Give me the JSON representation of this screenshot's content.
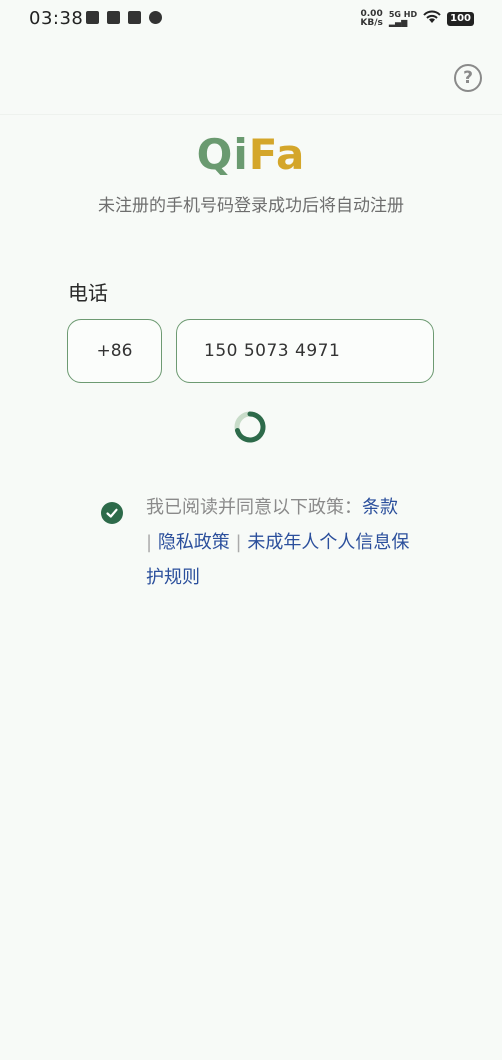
{
  "status_bar": {
    "time": "03:38",
    "net_speed_value": "0.00",
    "net_speed_unit": "KB/s",
    "signal_label": "5G HD",
    "battery": "100",
    "left_icons": [
      "shield-check-icon",
      "shield-icon",
      "mail-icon",
      "settings-icon"
    ]
  },
  "header": {
    "help_icon": "question-circle-icon",
    "help_glyph": "?"
  },
  "brand": {
    "logo_part1": "Qi",
    "logo_part2": "Fa",
    "color_part1": "#6a9a70",
    "color_part2": "#d4a62a"
  },
  "subtitle": "未注册的手机号码登录成功后将自动注册",
  "form": {
    "phone_label": "电话",
    "country_code": "+86",
    "phone_value": "150 5073 4971",
    "accent_color": "#6d9a72"
  },
  "agreement": {
    "checked": true,
    "prefix": "我已阅读并同意以下政策：",
    "terms": "条款",
    "separator": "|",
    "privacy": "隐私政策",
    "minor": "未成年人个人信息保护规则",
    "link_color": "#2b4f9c"
  }
}
